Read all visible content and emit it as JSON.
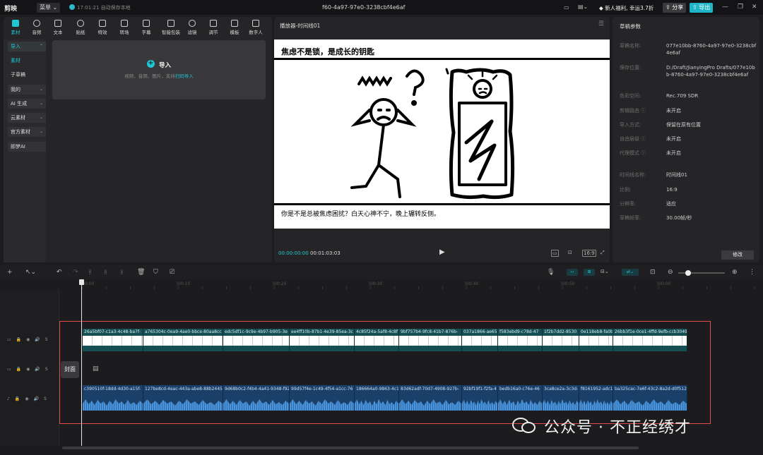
{
  "titlebar": {
    "logo": "剪映",
    "menu": "菜单",
    "save_status": "17:01:21 自动保存本地",
    "project_title": "f60-4a97-97e0-3238cbf4e6af",
    "promo": "新人福利, 幸运3.7折",
    "share": "分享",
    "export": "导出"
  },
  "toolbar": {
    "items": [
      "素材",
      "音频",
      "文本",
      "贴纸",
      "特效",
      "转场",
      "字幕",
      "智能包装",
      "滤镜",
      "调节",
      "模板",
      "数字人"
    ]
  },
  "sidebar": {
    "items": [
      {
        "label": "导入",
        "type": "group-active"
      },
      {
        "label": "素材",
        "type": "active"
      },
      {
        "label": "子草稿",
        "type": "plain"
      },
      {
        "label": "我的",
        "type": "group"
      },
      {
        "label": "AI 生成",
        "type": "group"
      },
      {
        "label": "云素材",
        "type": "group"
      },
      {
        "label": "官方素材",
        "type": "group"
      },
      {
        "label": "即梦AI",
        "type": "group-plain"
      }
    ]
  },
  "importbox": {
    "label": "导入",
    "hint_prefix": "视频、音频、图片，支持",
    "hint_link": "扫码导入"
  },
  "player": {
    "title": "播放器-时间线01",
    "headline": "焦虑不是锁，是成长的钥匙",
    "subtitle": "你是不是总被焦虑困扰？白天心神不宁，晚上辗转反侧。",
    "current_time": "00:00:00:00",
    "total_time": "00:01:03:03",
    "ratio": "16:9"
  },
  "draft": {
    "title": "草稿参数",
    "rows": [
      {
        "k": "草稿名称:",
        "v": "077e10bb-8760-4a97-97e0-3238cbf4e6af"
      },
      {
        "k": "保存位置:",
        "v": "D:/Draft/JianyingPro Drafts/077e10bb-8760-4a97-97e0-3238cbf4e6af"
      },
      {
        "k": "色彩空间:",
        "v": "Rec.709 SDR"
      },
      {
        "k": "剪辑路由 ⓘ",
        "v": "未开启"
      },
      {
        "k": "导入方式:",
        "v": "保留在原有位置"
      },
      {
        "k": "自由层级 ⓘ",
        "v": "未开启"
      },
      {
        "k": "代理模式 ⓘ",
        "v": "未开启"
      },
      {
        "k": "时间线名称:",
        "v": "时间线01"
      },
      {
        "k": "比例:",
        "v": "16:9"
      },
      {
        "k": "分辨率:",
        "v": "适应"
      },
      {
        "k": "草稿帧率:",
        "v": "30.00帧/秒"
      }
    ],
    "modify": "修改"
  },
  "ruler": [
    "00:00",
    "|00:10",
    "|00:20",
    "|00:30",
    "|00:40",
    "|00:50",
    "|00:00"
  ],
  "timeline": {
    "cover_label": "封面",
    "video_clips": [
      "26a5bf07-c1a3-4c48-ba7f-",
      "a765304c-0ea9-4ae0-bbce-80aa8cc",
      "edc5df1c-9c9e-4b97-b905-3e",
      "ee4ff10b-87b1-4e39-85ea-3c",
      "4c85f24a-5af8-4c8f",
      "9bf757b4-9fc8-41b7-876b-",
      "037a1866-ae65",
      "f583ebd9-c78d-47",
      "1f2b7dd2-8530",
      "0e118eb8-fa0b",
      "26bb3f1e-0ce1-4ffd-9efb-ccb3049"
    ],
    "audio_clips": [
      "c390510f-18dd-4d30-a15f-",
      "127be8cd-4eac-443a-abe8-88b2445",
      "9d68b0c2-f4b4-4a41-9348-f92",
      "99d57f4e-1c49-4f54-a1cc-76",
      "186664a0-9863-4c1",
      "83d62adf-70d7-4908-927b-",
      "92bf19f1-f2fa-4",
      "bedb16a0-c76e-46",
      "3ca8ce2a-3c3d-",
      "f8161952-adc1",
      "ba325cac-7e6f-43c2-8a2d-d0f512c"
    ]
  },
  "watermark": "公众号 · 不正经绣才",
  "colors": {
    "accent": "#1fc6d4",
    "export": "#1fb5c7",
    "redbox": "#e34a4a",
    "video": "#154e53",
    "audio": "#1a3f68"
  }
}
